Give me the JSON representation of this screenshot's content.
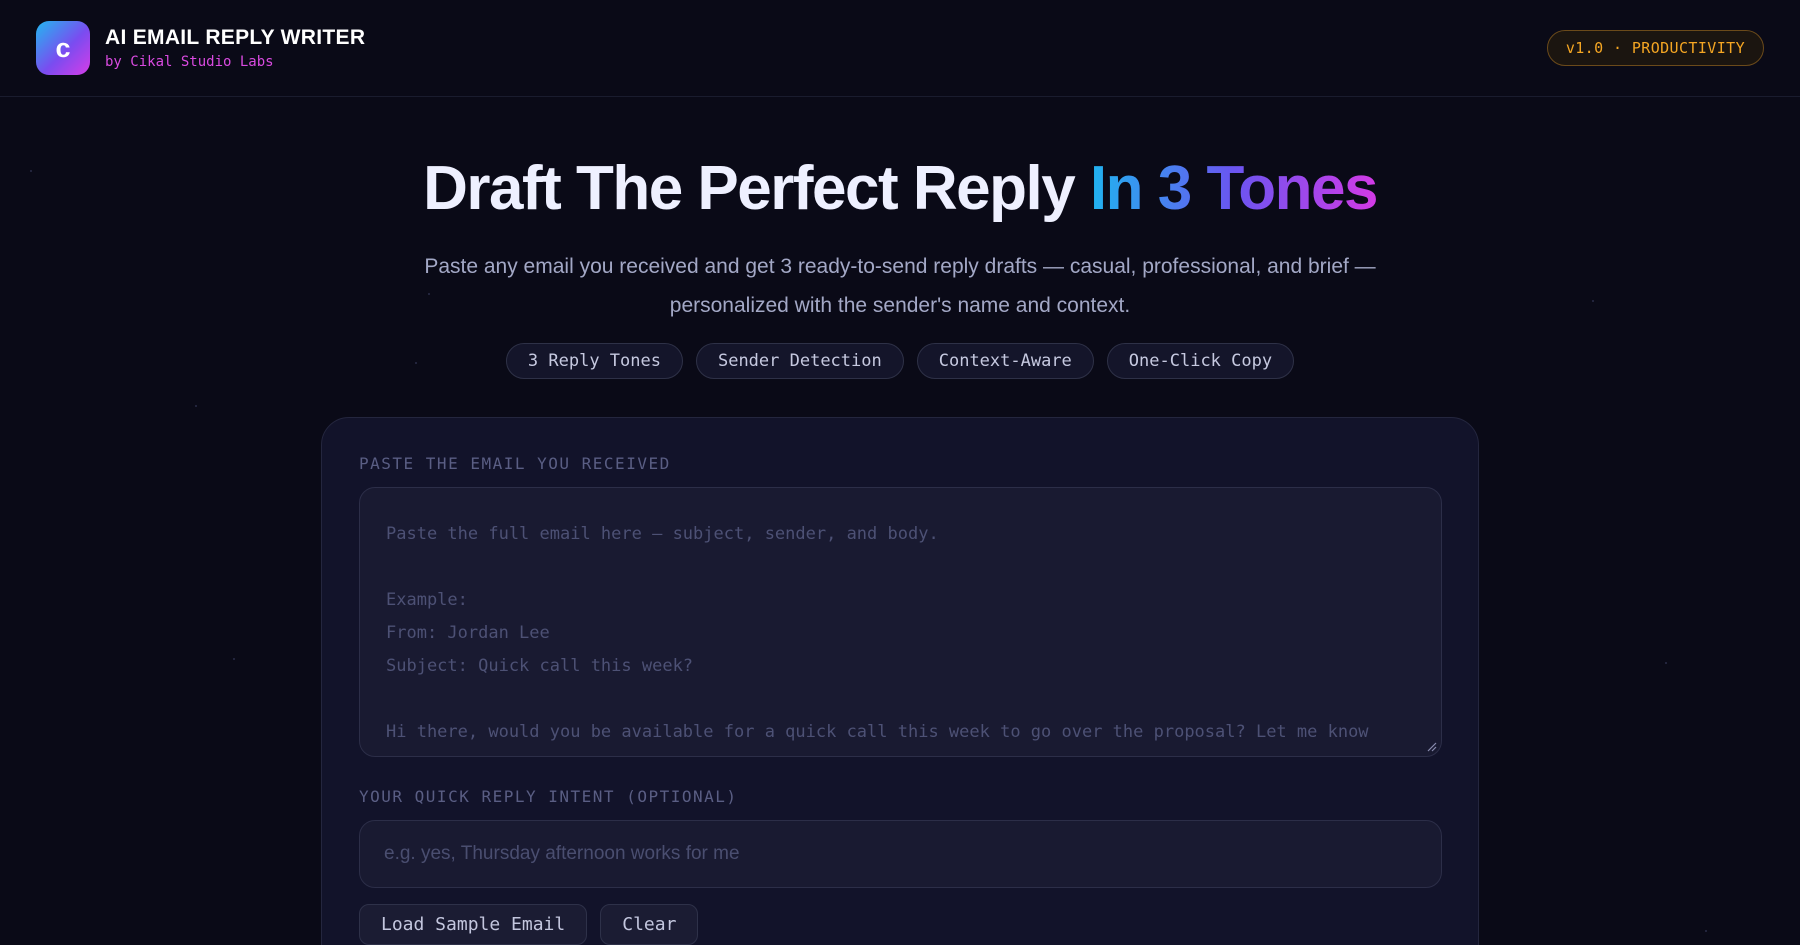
{
  "header": {
    "logo_letter": "c",
    "title": "AI EMAIL REPLY WRITER",
    "subtitle": "by Cikal Studio Labs",
    "version_badge": "v1.0 · PRODUCTIVITY"
  },
  "hero": {
    "title_plain": "Draft The Perfect Reply ",
    "title_highlight": "In 3 Tones",
    "description": "Paste any email you received and get 3 ready-to-send reply drafts — casual, professional, and brief — personalized with the sender's name and context.",
    "chips": [
      "3 Reply Tones",
      "Sender Detection",
      "Context-Aware",
      "One-Click Copy"
    ]
  },
  "form": {
    "email_label": "PASTE THE EMAIL YOU RECEIVED",
    "email_placeholder": "Paste the full email here — subject, sender, and body.\n\nExample:\nFrom: Jordan Lee\nSubject: Quick call this week?\n\nHi there, would you be available for a quick call this week to go over the proposal? Let me know what works.",
    "intent_label": "YOUR QUICK REPLY INTENT (OPTIONAL)",
    "intent_placeholder": "e.g. yes, Thursday afternoon works for me",
    "load_sample_label": "Load Sample Email",
    "clear_label": "Clear"
  },
  "colors": {
    "background": "#0a0a17",
    "brand_magenta": "#d94ae0",
    "badge_orange": "#f5a623",
    "gradient_start": "#20b4f0",
    "gradient_end": "#d33ae6"
  }
}
